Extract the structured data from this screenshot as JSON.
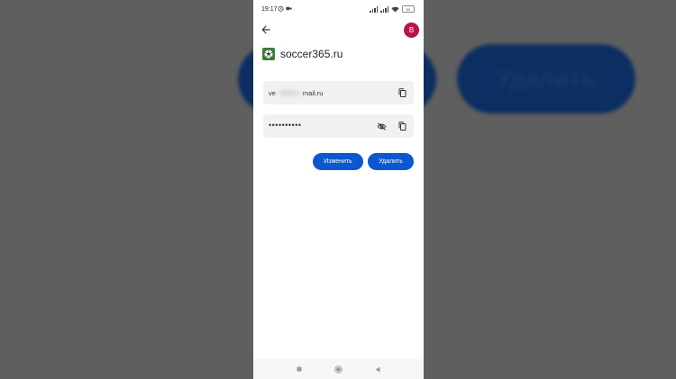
{
  "background": {
    "left_pill_text": "",
    "right_pill_text": "Удалить"
  },
  "status_bar": {
    "time": "19:17",
    "battery": "69"
  },
  "header": {
    "avatar_letter": "B"
  },
  "site": {
    "name": "soccer365.ru",
    "icon": "soccer-ball-icon"
  },
  "credentials": {
    "email_prefix": "ve",
    "email_suffix": "mail.ru",
    "password_mask": "••••••••••"
  },
  "actions": {
    "edit_label": "Изменить",
    "delete_label": "Удалить"
  },
  "colors": {
    "accent": "#0b57d0",
    "avatar": "#b8124f",
    "field_bg": "#f1f1f1"
  }
}
